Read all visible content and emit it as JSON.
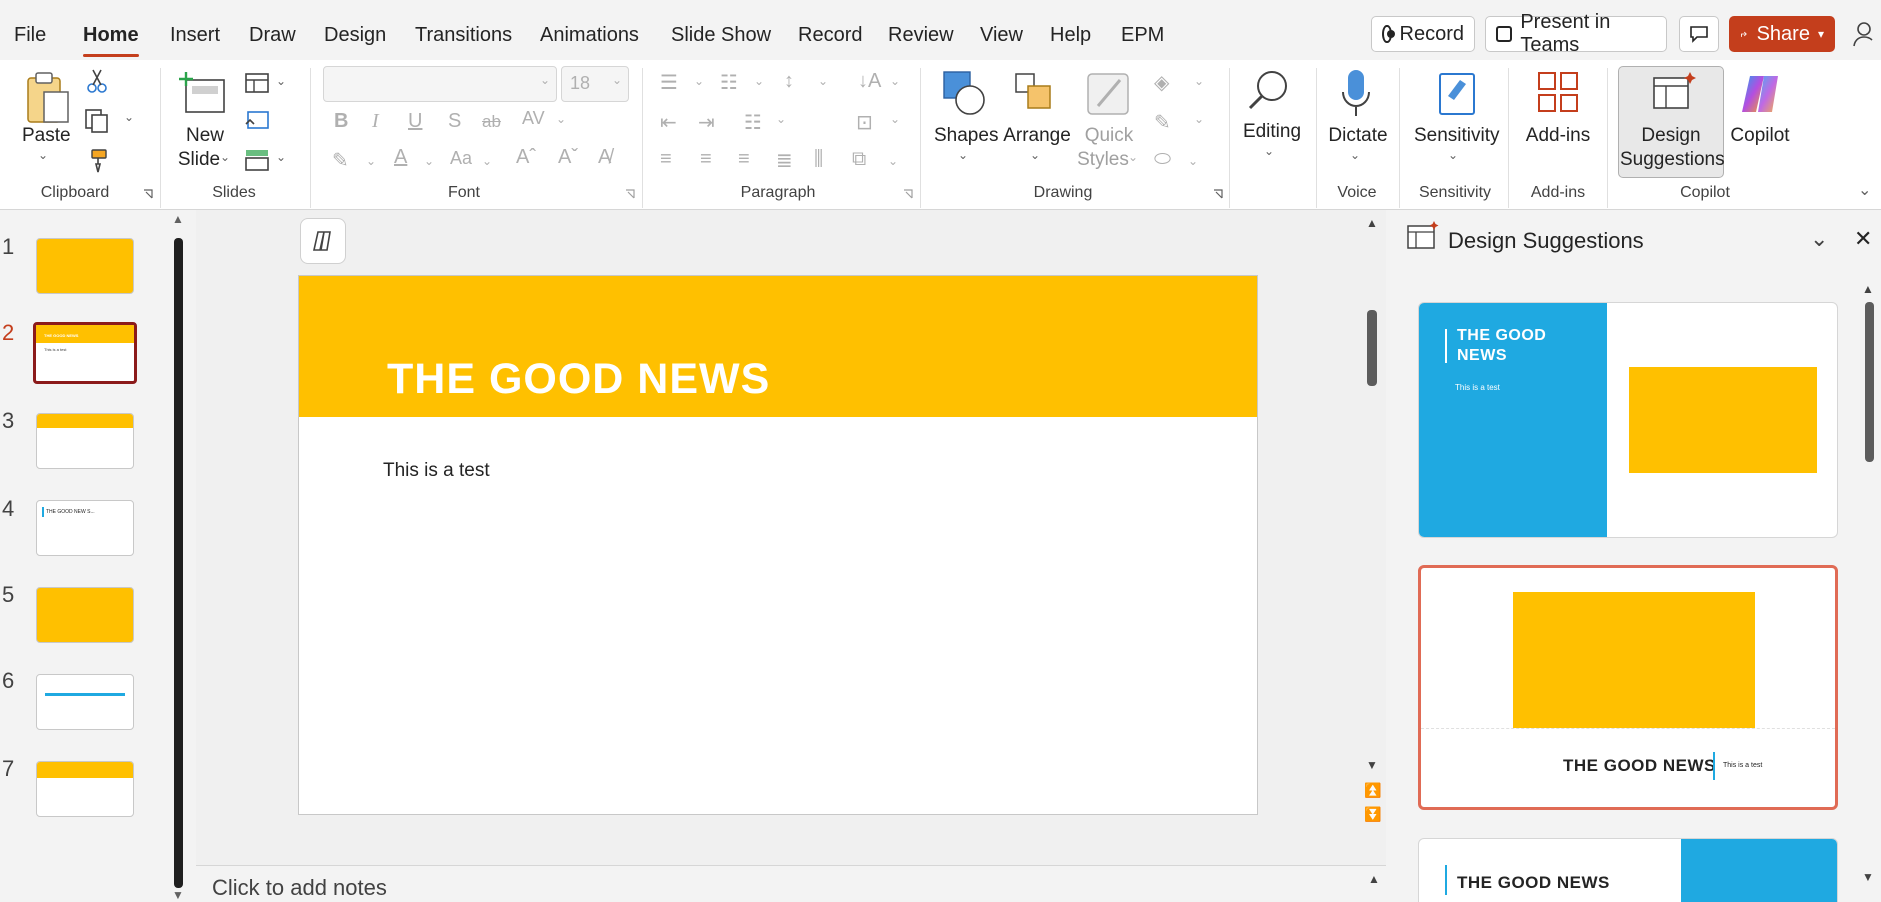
{
  "menu": {
    "tabs": [
      "File",
      "Home",
      "Insert",
      "Draw",
      "Design",
      "Transitions",
      "Animations",
      "Slide Show",
      "Record",
      "Review",
      "View",
      "Help",
      "EPM"
    ],
    "active": "Home",
    "record_label": "Record",
    "present_label": "Present in Teams",
    "share_label": "Share"
  },
  "ribbon": {
    "clipboard": {
      "label": "Clipboard",
      "paste": "Paste"
    },
    "slides": {
      "label": "Slides",
      "new_slide_line1": "New",
      "new_slide_line2": "Slide"
    },
    "font": {
      "label": "Font",
      "size": "18"
    },
    "paragraph": {
      "label": "Paragraph"
    },
    "drawing": {
      "label": "Drawing",
      "shapes": "Shapes",
      "arrange": "Arrange",
      "quick1": "Quick",
      "quick2": "Styles"
    },
    "editing": {
      "label": "Editing"
    },
    "voice": {
      "label": "Voice",
      "dictate": "Dictate"
    },
    "sensitivity": {
      "label": "Sensitivity",
      "button": "Sensitivity"
    },
    "addins": {
      "label": "Add-ins",
      "button": "Add-ins"
    },
    "copilot": {
      "label": "Copilot",
      "design1": "Design",
      "design2": "Suggestions",
      "copilot": "Copilot"
    }
  },
  "thumbnails": {
    "numbers": [
      "1",
      "2",
      "3",
      "4",
      "5",
      "6",
      "7"
    ],
    "selected": 2,
    "t2_title": "THE GOOD NEWS",
    "t2_body": "This is a test",
    "t4_title": "THE GOOD NEW S..."
  },
  "slide": {
    "title": "THE GOOD NEWS",
    "body": "This is a test"
  },
  "notes": {
    "placeholder": "Click to add notes"
  },
  "design_pane": {
    "title": "Design Suggestions",
    "card1_title_line1": "THE GOOD",
    "card1_title_line2": "NEWS",
    "card1_body": "This is a test",
    "card2_title": "THE GOOD NEWS",
    "card2_body": "This is a test",
    "card3_title": "THE GOOD NEWS"
  },
  "colors": {
    "accent": "#c43e1c",
    "slide_band": "#ffc000",
    "design_blue": "#1fa9e1"
  }
}
